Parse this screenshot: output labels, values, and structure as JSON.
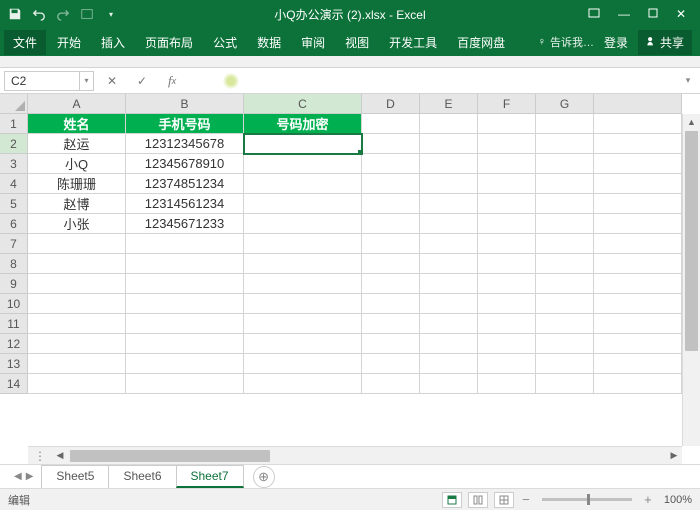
{
  "app": {
    "title": "小Q办公演示 (2).xlsx - Excel"
  },
  "ribbon": {
    "tabs": [
      "文件",
      "开始",
      "插入",
      "页面布局",
      "公式",
      "数据",
      "审阅",
      "视图",
      "开发工具",
      "百度网盘"
    ],
    "tell_me": "告诉我…",
    "login": "登录",
    "share": "共享"
  },
  "formula_bar": {
    "name_box": "C2",
    "formula": ""
  },
  "grid": {
    "columns": [
      "A",
      "B",
      "C",
      "D",
      "E",
      "F",
      "G"
    ],
    "active_col": "C",
    "active_row": 2,
    "row_count": 14,
    "headers": {
      "A": "姓名",
      "B": "手机号码",
      "C": "号码加密"
    },
    "rows": [
      {
        "A": "赵运",
        "B": "12312345678"
      },
      {
        "A": "小Q",
        "B": "12345678910"
      },
      {
        "A": "陈珊珊",
        "B": "12374851234"
      },
      {
        "A": "赵博",
        "B": "12314561234"
      },
      {
        "A": "小张",
        "B": "12345671233"
      }
    ]
  },
  "sheets": {
    "tabs": [
      "Sheet5",
      "Sheet6",
      "Sheet7"
    ],
    "active": "Sheet7"
  },
  "status": {
    "mode": "编辑",
    "zoom": "100%"
  }
}
